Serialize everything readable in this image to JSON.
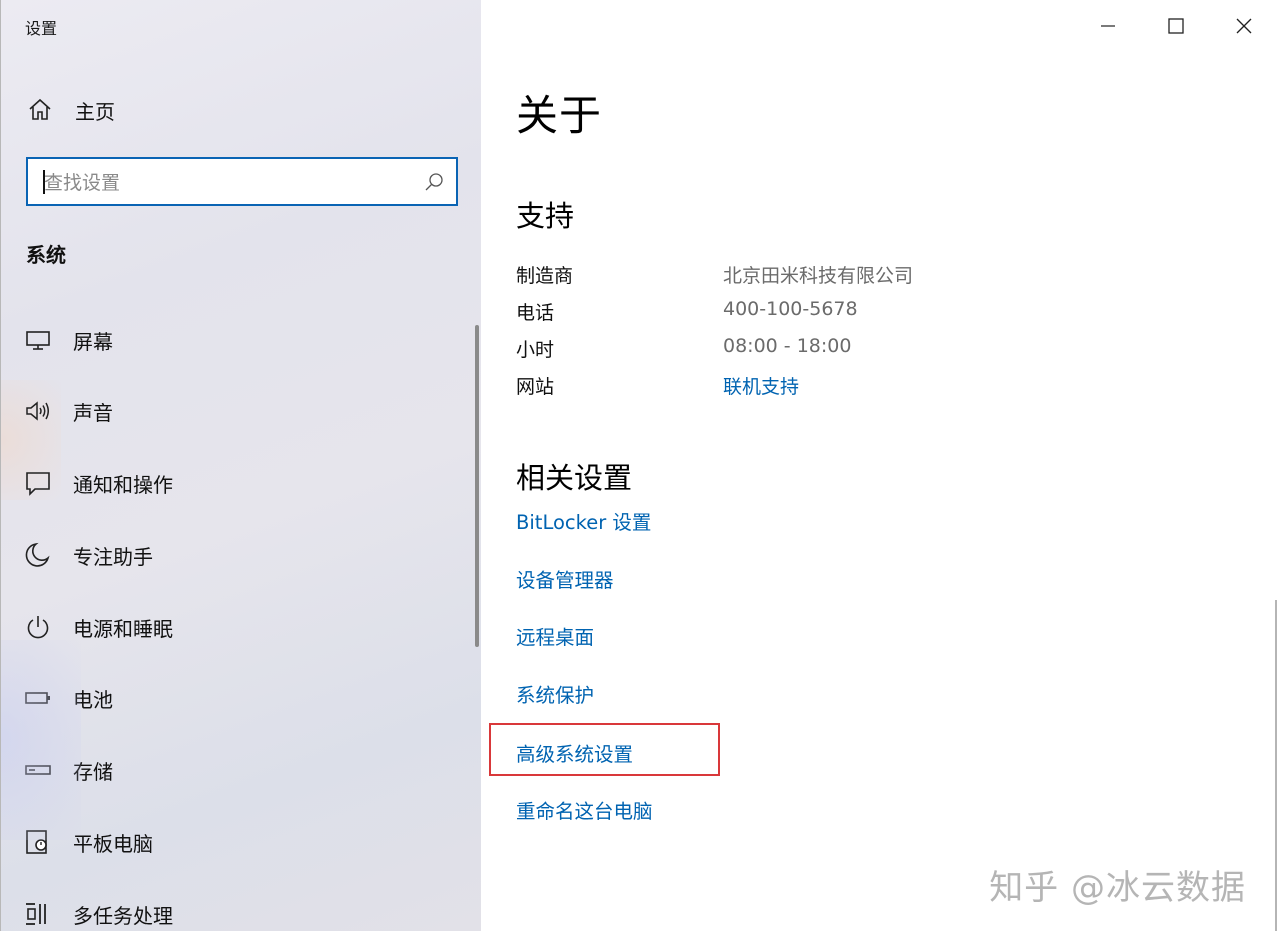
{
  "window": {
    "title": "设置"
  },
  "sidebar": {
    "home_label": "主页",
    "search": {
      "placeholder": "查找设置",
      "value": ""
    },
    "section_label": "系统",
    "items": [
      {
        "label": "屏幕",
        "icon": "monitor-icon"
      },
      {
        "label": "声音",
        "icon": "speaker-icon"
      },
      {
        "label": "通知和操作",
        "icon": "notification-icon"
      },
      {
        "label": "专注助手",
        "icon": "moon-icon"
      },
      {
        "label": "电源和睡眠",
        "icon": "power-icon"
      },
      {
        "label": "电池",
        "icon": "battery-icon"
      },
      {
        "label": "存储",
        "icon": "storage-icon"
      },
      {
        "label": "平板电脑",
        "icon": "tablet-icon"
      },
      {
        "label": "多任务处理",
        "icon": "multitask-icon"
      }
    ]
  },
  "main": {
    "title": "关于",
    "support": {
      "heading": "支持",
      "rows": [
        {
          "key": "制造商",
          "value": "北京田米科技有限公司"
        },
        {
          "key": "电话",
          "value": "400-100-5678"
        },
        {
          "key": "小时",
          "value": "08:00 - 18:00"
        },
        {
          "key": "网站",
          "value": "联机支持"
        }
      ]
    },
    "related": {
      "heading": "相关设置",
      "links": [
        "BitLocker 设置",
        "设备管理器",
        "远程桌面",
        "系统保护",
        "高级系统设置",
        "重命名这台电脑"
      ]
    }
  },
  "watermark": "知乎 @冰云数据",
  "colors": {
    "accent": "#0063b1",
    "search_border": "#0a64b4",
    "highlight": "#d9383a",
    "muted_text": "#6b6b6b"
  }
}
